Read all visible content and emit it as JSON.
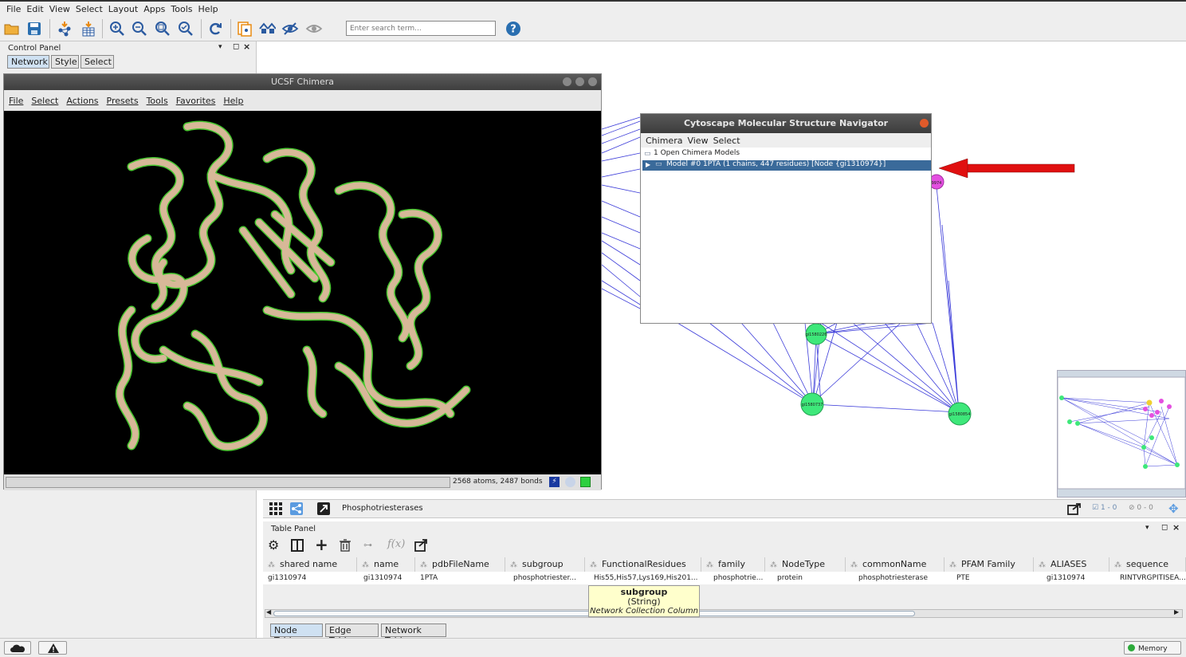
{
  "menubar": [
    "File",
    "Edit",
    "View",
    "Select",
    "Layout",
    "Apps",
    "Tools",
    "Help"
  ],
  "search": {
    "placeholder": "Enter search term..."
  },
  "control_panel": {
    "title": "Control Panel",
    "tabs": [
      "Network",
      "Style",
      "Select"
    ]
  },
  "chimera": {
    "title": "UCSF Chimera",
    "menu": [
      "File",
      "Select",
      "Actions",
      "Presets",
      "Tools",
      "Favorites",
      "Help"
    ],
    "status": "2568 atoms, 2487 bonds"
  },
  "navigator": {
    "title": "Cytoscape Molecular Structure Navigator",
    "menu": [
      "Chimera",
      "View",
      "Select"
    ],
    "tree_root": "1 Open Chimera Models",
    "tree_item": "Model #0 1PTA (1 chains, 447 residues) [Node {gi1310974}]"
  },
  "network": {
    "nodes": [
      "gi1310974",
      "gi1580226",
      "gi1580737",
      "gi1580854"
    ],
    "colors": {
      "edge": "#3b3bd9",
      "node_green": "#3ee87a",
      "node_pink": "#e44fe0",
      "arrow": "#e01010"
    }
  },
  "network_status": {
    "name": "Phosphotriesterases",
    "selected_nodes": "1 - 0",
    "hidden": "0 - 0"
  },
  "table_panel": {
    "title": "Table Panel",
    "columns": [
      "shared name",
      "name",
      "pdbFileName",
      "subgroup",
      "FunctionalResidues",
      "family",
      "NodeType",
      "commonName",
      "PFAM Family",
      "ALIASES",
      "sequence"
    ],
    "row": [
      "gi1310974",
      "gi1310974",
      "1PTA",
      "phosphotriester...",
      "His55,His57,Lys169,His201...",
      "phosphotrie...",
      "protein",
      "phosphotriesterase",
      "PTE",
      "gi1310974",
      "RINTVRGPITISEA..."
    ],
    "fx": "f(x)",
    "tooltip": {
      "title": "subgroup",
      "type": "(String)",
      "kind": "Network Collection Column"
    },
    "tabs": [
      "Node Table",
      "Edge Table",
      "Network Table"
    ]
  },
  "bottom": {
    "memory": "Memory"
  }
}
